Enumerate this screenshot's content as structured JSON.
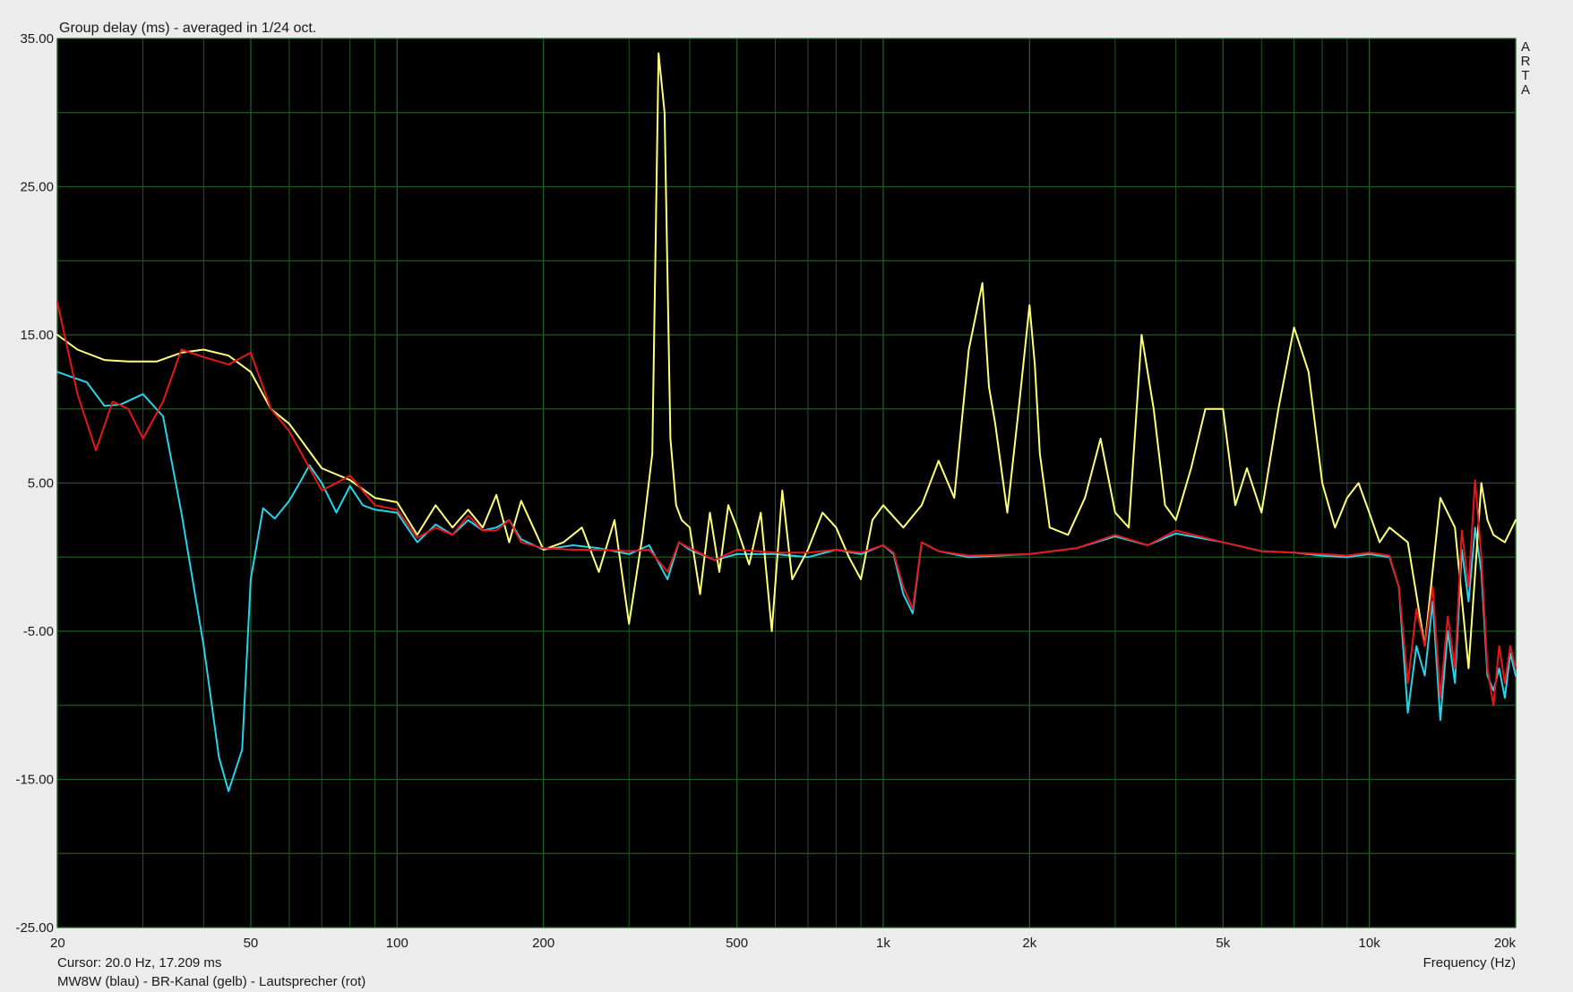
{
  "chart_data": {
    "type": "line",
    "title": "Group delay (ms) - averaged in 1/24 oct.",
    "xlabel": "Frequency (Hz)",
    "ylabel": "",
    "x_scale": "log",
    "xlim": [
      20,
      20000
    ],
    "ylim": [
      -25,
      35
    ],
    "grid": true,
    "background": "#000000",
    "grid_color": "#1f5a1f",
    "x_ticks": [
      {
        "value": 20,
        "label": "20"
      },
      {
        "value": 50,
        "label": "50"
      },
      {
        "value": 100,
        "label": "100"
      },
      {
        "value": 200,
        "label": "200"
      },
      {
        "value": 500,
        "label": "500"
      },
      {
        "value": 1000,
        "label": "1k"
      },
      {
        "value": 2000,
        "label": "2k"
      },
      {
        "value": 5000,
        "label": "5k"
      },
      {
        "value": 10000,
        "label": "10k"
      },
      {
        "value": 20000,
        "label": "20k"
      }
    ],
    "x_minor_grid": [
      30,
      40,
      60,
      70,
      80,
      90,
      300,
      400,
      600,
      700,
      800,
      900,
      3000,
      4000,
      6000,
      7000,
      8000,
      9000
    ],
    "y_ticks": [
      {
        "value": 35,
        "label": "35.00"
      },
      {
        "value": 25,
        "label": "25.00"
      },
      {
        "value": 15,
        "label": "15.00"
      },
      {
        "value": 5,
        "label": "5.00"
      },
      {
        "value": -5,
        "label": "-5.00"
      },
      {
        "value": -15,
        "label": "-15.00"
      },
      {
        "value": -25,
        "label": "-25.00"
      }
    ],
    "y_minor_grid": [
      30,
      20,
      10,
      0,
      -10,
      -20
    ],
    "series": [
      {
        "name": "MW8W",
        "color": "#27d3e8",
        "x": [
          20,
          23,
          25,
          27,
          30,
          33,
          36,
          40,
          43,
          45,
          48,
          50,
          53,
          56,
          60,
          63,
          66,
          70,
          75,
          80,
          85,
          90,
          100,
          110,
          120,
          130,
          140,
          150,
          160,
          170,
          180,
          200,
          230,
          260,
          300,
          330,
          360,
          380,
          400,
          450,
          500,
          600,
          700,
          800,
          900,
          1000,
          1050,
          1100,
          1150,
          1200,
          1300,
          1500,
          2000,
          2500,
          3000,
          3500,
          4000,
          5000,
          6000,
          7000,
          8000,
          9000,
          10000,
          11000,
          11500,
          12000,
          12500,
          13000,
          13500,
          14000,
          14500,
          15000,
          15500,
          16000,
          16500,
          17000,
          17500,
          18000,
          18500,
          19000,
          19500,
          20000
        ],
        "y": [
          12.5,
          11.8,
          10.2,
          10.3,
          11.0,
          9.5,
          3.0,
          -6.0,
          -13.5,
          -15.8,
          -13.0,
          -1.5,
          3.3,
          2.6,
          3.8,
          5.0,
          6.2,
          5.0,
          3.0,
          4.8,
          3.5,
          3.2,
          3.0,
          1.0,
          2.2,
          1.5,
          2.5,
          1.8,
          2.0,
          2.5,
          1.2,
          0.5,
          0.8,
          0.6,
          0.2,
          0.8,
          -1.5,
          1.0,
          0.5,
          -0.2,
          0.2,
          0.2,
          0.0,
          0.5,
          0.2,
          0.8,
          0.2,
          -2.5,
          -3.8,
          1.0,
          0.4,
          0.0,
          0.2,
          0.6,
          1.4,
          0.8,
          1.6,
          1.0,
          0.4,
          0.3,
          0.1,
          0.0,
          0.2,
          0.0,
          -2.0,
          -10.5,
          -6.0,
          -8.0,
          -3.0,
          -11.0,
          -5.0,
          -8.5,
          0.5,
          -3.0,
          2.0,
          -1.0,
          -8.0,
          -9.0,
          -7.5,
          -9.5,
          -6.5,
          -8.0
        ]
      },
      {
        "name": "BR-Kanal",
        "color": "#ffff7a",
        "x": [
          20,
          22,
          25,
          28,
          32,
          36,
          40,
          45,
          50,
          55,
          60,
          70,
          80,
          90,
          100,
          110,
          120,
          130,
          140,
          150,
          160,
          170,
          180,
          200,
          220,
          240,
          260,
          280,
          300,
          320,
          335,
          345,
          355,
          365,
          375,
          385,
          400,
          420,
          440,
          460,
          480,
          500,
          530,
          560,
          590,
          620,
          650,
          700,
          750,
          800,
          850,
          900,
          950,
          1000,
          1100,
          1200,
          1300,
          1400,
          1500,
          1600,
          1650,
          1700,
          1800,
          1900,
          2000,
          2050,
          2100,
          2200,
          2400,
          2600,
          2800,
          3000,
          3200,
          3400,
          3600,
          3800,
          4000,
          4300,
          4600,
          5000,
          5300,
          5600,
          6000,
          6500,
          7000,
          7500,
          8000,
          8500,
          9000,
          9500,
          10000,
          10500,
          11000,
          12000,
          13000,
          14000,
          15000,
          16000,
          17000,
          17500,
          18000,
          19000,
          20000
        ],
        "y": [
          15.0,
          14.0,
          13.3,
          13.2,
          13.2,
          13.8,
          14.0,
          13.6,
          12.5,
          10.0,
          9.0,
          6.0,
          5.2,
          4.0,
          3.7,
          1.5,
          3.5,
          2.0,
          3.2,
          2.0,
          4.2,
          1.0,
          3.8,
          0.5,
          1.0,
          2.0,
          -1.0,
          2.5,
          -4.5,
          1.5,
          7.0,
          34.0,
          30.0,
          8.0,
          3.5,
          2.5,
          2.0,
          -2.5,
          3.0,
          -1.0,
          3.5,
          2.0,
          -0.5,
          3.0,
          -5.0,
          4.5,
          -1.5,
          0.5,
          3.0,
          2.0,
          0.0,
          -1.5,
          2.5,
          3.5,
          2.0,
          3.5,
          6.5,
          4.0,
          14.0,
          18.5,
          11.5,
          9.0,
          3.0,
          10.0,
          17.0,
          13.0,
          7.0,
          2.0,
          1.5,
          4.0,
          8.0,
          3.0,
          2.0,
          15.0,
          10.0,
          3.5,
          2.5,
          6.0,
          10.0,
          10.0,
          3.5,
          6.0,
          3.0,
          10.0,
          15.5,
          12.5,
          5.0,
          2.0,
          4.0,
          5.0,
          3.0,
          1.0,
          2.0,
          1.0,
          -6.0,
          4.0,
          2.0,
          -7.5,
          5.0,
          2.5,
          1.5,
          1.0,
          2.5
        ]
      },
      {
        "name": "Lautsprecher",
        "color": "#e8161a",
        "x": [
          20,
          22,
          24,
          26,
          28,
          30,
          33,
          36,
          40,
          45,
          50,
          55,
          60,
          70,
          75,
          80,
          90,
          100,
          110,
          120,
          130,
          140,
          150,
          160,
          170,
          180,
          200,
          230,
          260,
          300,
          330,
          360,
          380,
          400,
          450,
          500,
          600,
          700,
          800,
          900,
          1000,
          1050,
          1100,
          1150,
          1200,
          1300,
          1500,
          2000,
          2500,
          3000,
          3500,
          4000,
          5000,
          6000,
          7000,
          8000,
          9000,
          10000,
          11000,
          11500,
          12000,
          12500,
          13000,
          13500,
          14000,
          14500,
          15000,
          15500,
          16000,
          16500,
          17000,
          17500,
          18000,
          18500,
          19000,
          19500,
          20000
        ],
        "y": [
          17.2,
          11.0,
          7.2,
          10.5,
          10.0,
          8.0,
          10.5,
          14.0,
          13.5,
          13.0,
          13.8,
          10.0,
          8.5,
          4.5,
          5.0,
          5.5,
          3.5,
          3.2,
          1.3,
          2.0,
          1.5,
          2.8,
          1.8,
          1.8,
          2.5,
          1.0,
          0.6,
          0.5,
          0.5,
          0.4,
          0.5,
          -1.0,
          1.0,
          0.6,
          -0.2,
          0.5,
          0.3,
          0.3,
          0.5,
          0.3,
          0.8,
          0.3,
          -2.0,
          -3.5,
          1.0,
          0.4,
          0.1,
          0.2,
          0.6,
          1.5,
          0.8,
          1.8,
          1.0,
          0.4,
          0.3,
          0.2,
          0.1,
          0.3,
          0.1,
          -2.0,
          -8.5,
          -3.5,
          -6.0,
          -2.0,
          -9.5,
          -4.0,
          -7.5,
          1.8,
          -2.0,
          5.2,
          0.0,
          -7.5,
          -10.0,
          -6.0,
          -8.5,
          -6.0,
          -7.5
        ]
      }
    ]
  },
  "cursor_text": "Cursor: 20.0 Hz, 17.209 ms",
  "legend_text": "MW8W (blau) - BR-Kanal (gelb) - Lautsprecher (rot)",
  "arta_letters": [
    "A",
    "R",
    "T",
    "A"
  ]
}
